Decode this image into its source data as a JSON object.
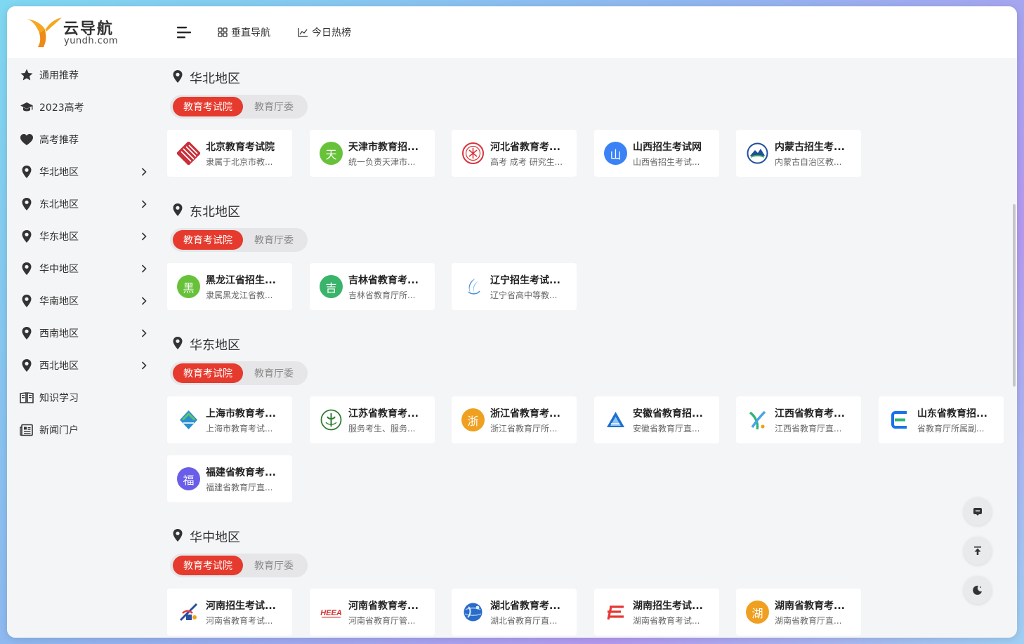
{
  "logo": {
    "cn": "云导航",
    "en": "yundh.com"
  },
  "topbar": {
    "vertical_nav": "垂直导航",
    "hot_today": "今日热榜"
  },
  "sidebar": {
    "items": [
      {
        "label": "通用推荐",
        "icon": "star-icon",
        "chevron": false
      },
      {
        "label": "2023高考",
        "icon": "graduation-cap-icon",
        "chevron": false
      },
      {
        "label": "高考推荐",
        "icon": "heart-icon",
        "chevron": false
      },
      {
        "label": "华北地区",
        "icon": "location-pin-icon",
        "chevron": true
      },
      {
        "label": "东北地区",
        "icon": "location-pin-icon",
        "chevron": true
      },
      {
        "label": "华东地区",
        "icon": "location-pin-icon",
        "chevron": true
      },
      {
        "label": "华中地区",
        "icon": "location-pin-icon",
        "chevron": true
      },
      {
        "label": "华南地区",
        "icon": "location-pin-icon",
        "chevron": true
      },
      {
        "label": "西南地区",
        "icon": "location-pin-icon",
        "chevron": true
      },
      {
        "label": "西北地区",
        "icon": "location-pin-icon",
        "chevron": true
      },
      {
        "label": "知识学习",
        "icon": "book-icon",
        "chevron": false
      },
      {
        "label": "新闻门户",
        "icon": "newspaper-icon",
        "chevron": false
      }
    ]
  },
  "tabs": {
    "active": "教育考试院",
    "inactive": "教育厅委"
  },
  "sections": [
    {
      "title": "华北地区",
      "cards": [
        {
          "title": "北京教育考试院",
          "desc": "隶属于北京市教...",
          "logo": "beijing-logo-icon",
          "color": "#c8303a",
          "char": ""
        },
        {
          "title": "天津市教育招...",
          "desc": "统一负责天津市...",
          "logo": "tian-char-icon",
          "color": "#67c23a",
          "char": "天"
        },
        {
          "title": "河北省教育考...",
          "desc": "高考 成考 研究生...",
          "logo": "hebei-seal-icon",
          "color": "#d9343b",
          "char": ""
        },
        {
          "title": "山西招生考试网",
          "desc": "山西省招生考试...",
          "logo": "shan-char-icon",
          "color": "#3b82f6",
          "char": "山"
        },
        {
          "title": "内蒙古招生考...",
          "desc": "内蒙古自治区教...",
          "logo": "neimenggu-logo-icon",
          "color": "#1e4e9c",
          "char": ""
        }
      ]
    },
    {
      "title": "东北地区",
      "cards": [
        {
          "title": "黑龙江省招生...",
          "desc": "隶属黑龙江省教...",
          "logo": "hei-char-icon",
          "color": "#67c23a",
          "char": "黑"
        },
        {
          "title": "吉林省教育考...",
          "desc": "吉林省教育厅所...",
          "logo": "ji-char-icon",
          "color": "#3ab36b",
          "char": "吉"
        },
        {
          "title": "辽宁招生考试...",
          "desc": "辽宁省高中等教...",
          "logo": "liaoning-logo-icon",
          "color": "#4a90d9",
          "char": ""
        }
      ]
    },
    {
      "title": "华东地区",
      "cards": [
        {
          "title": "上海市教育考...",
          "desc": "上海市教育考试...",
          "logo": "shanghai-logo-icon",
          "color": "#2a8fd0",
          "char": ""
        },
        {
          "title": "江苏省教育考...",
          "desc": "服务考生、服务...",
          "logo": "jiangsu-logo-icon",
          "color": "#2e7d32",
          "char": ""
        },
        {
          "title": "浙江省教育考...",
          "desc": "浙江省教育厅所...",
          "logo": "zhe-char-icon",
          "color": "#f0a020",
          "char": "浙"
        },
        {
          "title": "安徽省教育招...",
          "desc": "安徽省教育厅直...",
          "logo": "anhui-logo-icon",
          "color": "#1e6fd0",
          "char": ""
        },
        {
          "title": "江西省教育考...",
          "desc": "江西省教育厅直...",
          "logo": "jiangxi-logo-icon",
          "color": "#2bb673",
          "char": ""
        },
        {
          "title": "山东省教育招...",
          "desc": "省教育厅所属副...",
          "logo": "shandong-logo-icon",
          "color": "#1a73e8",
          "char": ""
        },
        {
          "title": "福建省教育考...",
          "desc": "福建省教育厅直...",
          "logo": "fu-char-icon",
          "color": "#6a5de8",
          "char": "福"
        }
      ]
    },
    {
      "title": "华中地区",
      "cards": [
        {
          "title": "河南招生考试...",
          "desc": "河南省教育考试...",
          "logo": "henan-logo-icon",
          "color": "#2a4ea0",
          "char": ""
        },
        {
          "title": "河南省教育考...",
          "desc": "河南省教育厅管...",
          "logo": "heeea-logo-icon",
          "color": "#d32f2f",
          "char": ""
        },
        {
          "title": "湖北省教育考...",
          "desc": "湖北省教育厅直...",
          "logo": "hubei-globe-icon",
          "color": "#2a6cc8",
          "char": ""
        },
        {
          "title": "湖南招生考试...",
          "desc": "湖南省教育考试...",
          "logo": "hunan-logo-icon",
          "color": "#e53935",
          "char": ""
        },
        {
          "title": "湖南省教育考...",
          "desc": "湖南省教育厅直...",
          "logo": "hu-char-icon",
          "color": "#f0a020",
          "char": "湖"
        }
      ]
    }
  ],
  "float_buttons": [
    "chat-icon",
    "back-to-top-icon",
    "dark-mode-icon"
  ]
}
